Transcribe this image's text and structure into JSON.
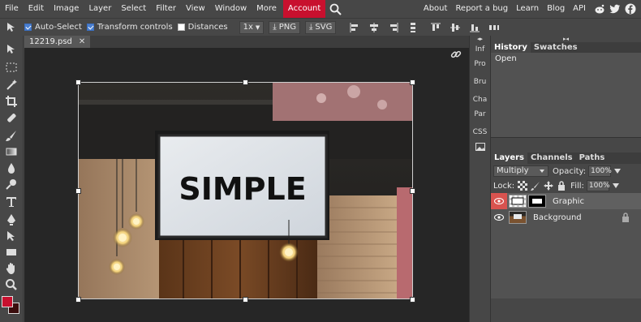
{
  "menu": {
    "items": [
      "File",
      "Edit",
      "Image",
      "Layer",
      "Select",
      "Filter",
      "View",
      "Window",
      "More"
    ],
    "account": "Account",
    "right_links": [
      "About",
      "Report a bug",
      "Learn",
      "Blog",
      "API"
    ],
    "social_icons": [
      "reddit-icon",
      "twitter-icon",
      "facebook-icon"
    ]
  },
  "options": {
    "auto_select": "Auto-Select",
    "auto_select_checked": true,
    "transform_controls": "Transform controls",
    "transform_controls_checked": true,
    "distances": "Distances",
    "distances_checked": false,
    "zoom": "1x",
    "png": "PNG",
    "svg": "SVG"
  },
  "document": {
    "tab_name": "12219.psd",
    "close": "✕"
  },
  "mini_panel": [
    "Inf",
    "Pro",
    "Bru",
    "Cha",
    "Par",
    "CSS"
  ],
  "history": {
    "tabs": [
      "History",
      "Swatches"
    ],
    "items": [
      "Open"
    ]
  },
  "layers": {
    "tabs": [
      "Layers",
      "Channels",
      "Paths"
    ],
    "blend_mode": "Multiply",
    "opacity_label": "Opacity:",
    "opacity_value": "100%",
    "lock_label": "Lock:",
    "fill_label": "Fill:",
    "fill_value": "100%",
    "rows": [
      {
        "name": "Graphic",
        "selected": true
      },
      {
        "name": "Background",
        "selected": false,
        "locked": true
      }
    ]
  },
  "colors": {
    "foreground": "#c8102e",
    "background": "#3a0d0d",
    "accent": "#c8102e"
  },
  "canvas": {
    "sign_text": "SIMPLE"
  }
}
